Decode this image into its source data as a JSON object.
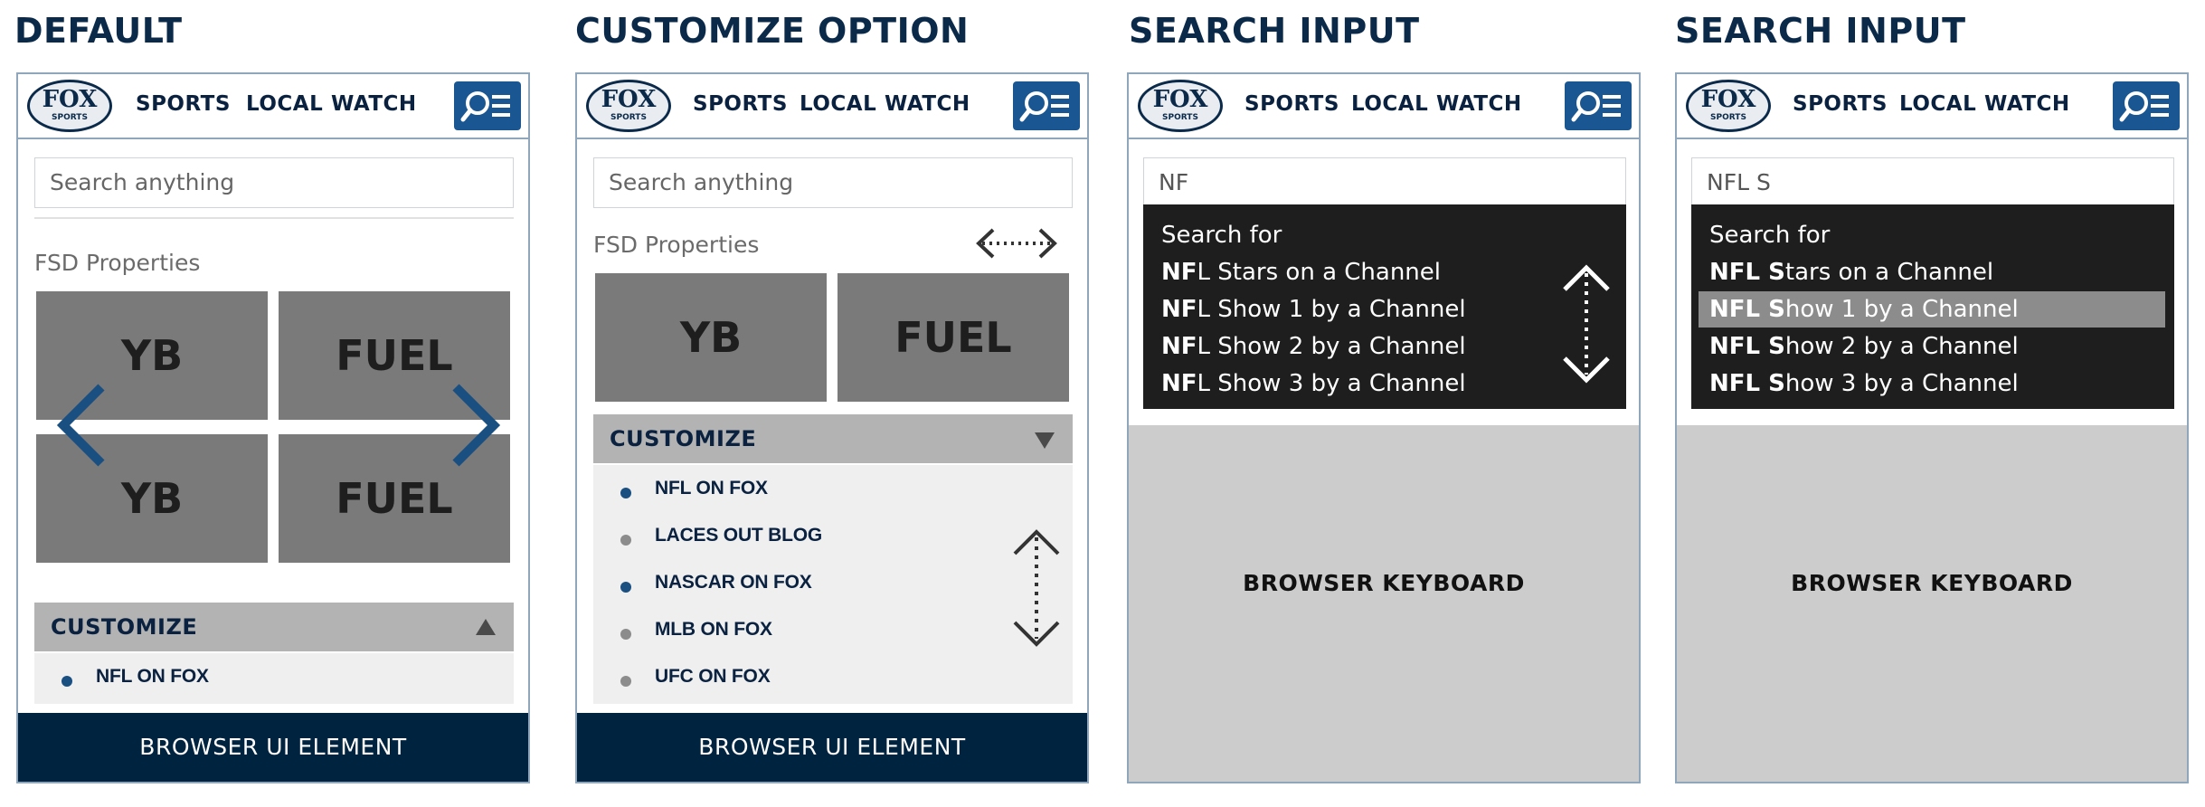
{
  "panels": [
    {
      "title": "DEFAULT"
    },
    {
      "title": "CUSTOMIZE OPTION"
    },
    {
      "title": "SEARCH INPUT"
    },
    {
      "title": "SEARCH INPUT"
    }
  ],
  "nav": {
    "logo_text": "FOX",
    "logo_sub": "SPORTS",
    "links": [
      "SPORTS",
      "LOCAL",
      "WATCH"
    ],
    "menu_icon": "search-menu-icon"
  },
  "search": {
    "placeholder": "Search anything"
  },
  "properties": {
    "label": "FSD Properties",
    "tiles": [
      "YB",
      "FUEL",
      "YB",
      "FUEL"
    ]
  },
  "customize": {
    "label": "CUSTOMIZE",
    "items": [
      {
        "label": "NFL ON FOX",
        "selected": true
      },
      {
        "label": "LACES OUT BLOG",
        "selected": false
      },
      {
        "label": "NASCAR ON FOX",
        "selected": true
      },
      {
        "label": "MLB ON FOX",
        "selected": false
      },
      {
        "label": "UFC ON FOX",
        "selected": false
      }
    ]
  },
  "browser_ui_label": "BROWSER UI ELEMENT",
  "search_input_1": {
    "value": "NF",
    "header": "Search for",
    "results": [
      {
        "bold": "NF",
        "rest": "L Stars on a Channel"
      },
      {
        "bold": "NF",
        "rest": "L Show 1 by a Channel"
      },
      {
        "bold": "NF",
        "rest": "L Show 2 by a Channel"
      },
      {
        "bold": "NF",
        "rest": "L Show 3 by a Channel"
      }
    ]
  },
  "search_input_2": {
    "value": "NFL S",
    "header": "Search for",
    "results": [
      {
        "bold": "NFL S",
        "rest": "tars on a Channel"
      },
      {
        "bold": "NFL S",
        "rest": "how 1 by a Channel",
        "highlighted": true
      },
      {
        "bold": "NFL S",
        "rest": "how 2 by a Channel"
      },
      {
        "bold": "NFL S",
        "rest": "how 3 by a Channel"
      }
    ]
  },
  "keyboard_label": "BROWSER KEYBOARD",
  "colors": {
    "nav_blue": "#1a5691",
    "dark_navy": "#00233f",
    "selected_dot": "#1a4f82",
    "unselected_dot": "#8c8c8c",
    "tile_gray": "#7a7a7a",
    "highlight_row": "#8c8c8c"
  }
}
